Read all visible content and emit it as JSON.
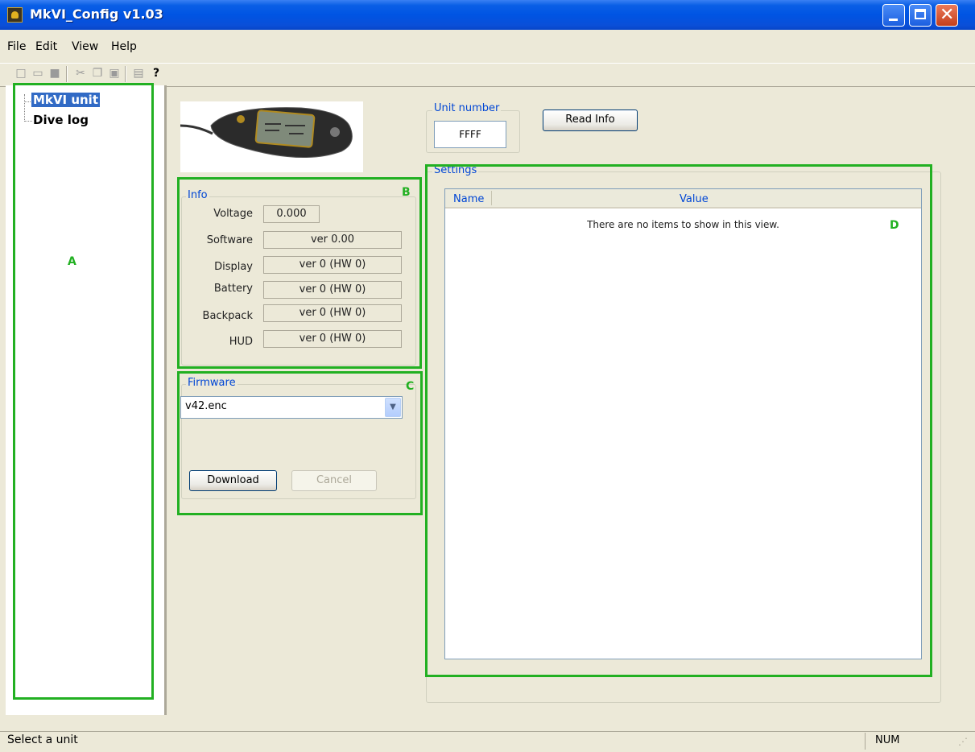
{
  "window": {
    "title": "MkVI_Config v1.03"
  },
  "menu": {
    "file": "File",
    "edit": "Edit",
    "view": "View",
    "help": "Help"
  },
  "tree": {
    "items": [
      "MkVI unit",
      "Dive log"
    ]
  },
  "annotations": {
    "a": "A",
    "b": "B",
    "c": "C",
    "d": "D"
  },
  "unit": {
    "label": "Unit number",
    "value": "FFFF",
    "read_button": "Read Info"
  },
  "info": {
    "title": "Info",
    "rows": [
      {
        "label": "Voltage",
        "value": "0.000"
      },
      {
        "label": "Software",
        "value": "ver 0.00"
      },
      {
        "label": "Display",
        "value": "ver 0  (HW 0)"
      },
      {
        "label": "Battery",
        "value": "ver 0  (HW 0)"
      },
      {
        "label": "Backpack",
        "value": "ver 0  (HW 0)"
      },
      {
        "label": "HUD",
        "value": "ver 0  (HW 0)"
      }
    ]
  },
  "firmware": {
    "title": "Firmware",
    "selected": "v42.enc",
    "download": "Download",
    "cancel": "Cancel"
  },
  "settings": {
    "title": "Settings",
    "col_name": "Name",
    "col_value": "Value",
    "empty_text": "There are no items to show in this view."
  },
  "status": {
    "text": "Select a unit",
    "num": "NUM"
  },
  "colors": {
    "titlebar": "#0054e3",
    "annotation": "#22b022",
    "group_title": "#0046d5",
    "tree_selection": "#316ac5"
  }
}
